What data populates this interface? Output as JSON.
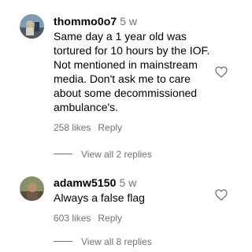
{
  "comments": [
    {
      "username": "thommo0o7",
      "time": "5 w",
      "text": "Same day a 1 year old was tortured for 10 hours by the IOF. Not mentioned in mainstream media. Don't ask me to care about some decommissioned ambulance's.",
      "likes": "258 likes",
      "reply_label": "Reply",
      "view_replies": "View all 2 replies",
      "avatar_colors": [
        "#7d9bb3",
        "#c9b89a",
        "#4f5a63"
      ]
    },
    {
      "username": "adamw5150",
      "time": "5 w",
      "text": "Always a false flag",
      "likes": "603 likes",
      "reply_label": "Reply",
      "view_replies": "View all 8 replies",
      "avatar_colors": [
        "#8a8f6a",
        "#b58f6e",
        "#5a4b3c"
      ]
    }
  ],
  "icons": {
    "like": "heart-outline-icon"
  },
  "colors": {
    "secondary_text": "#737373",
    "primary_text": "#000000"
  }
}
